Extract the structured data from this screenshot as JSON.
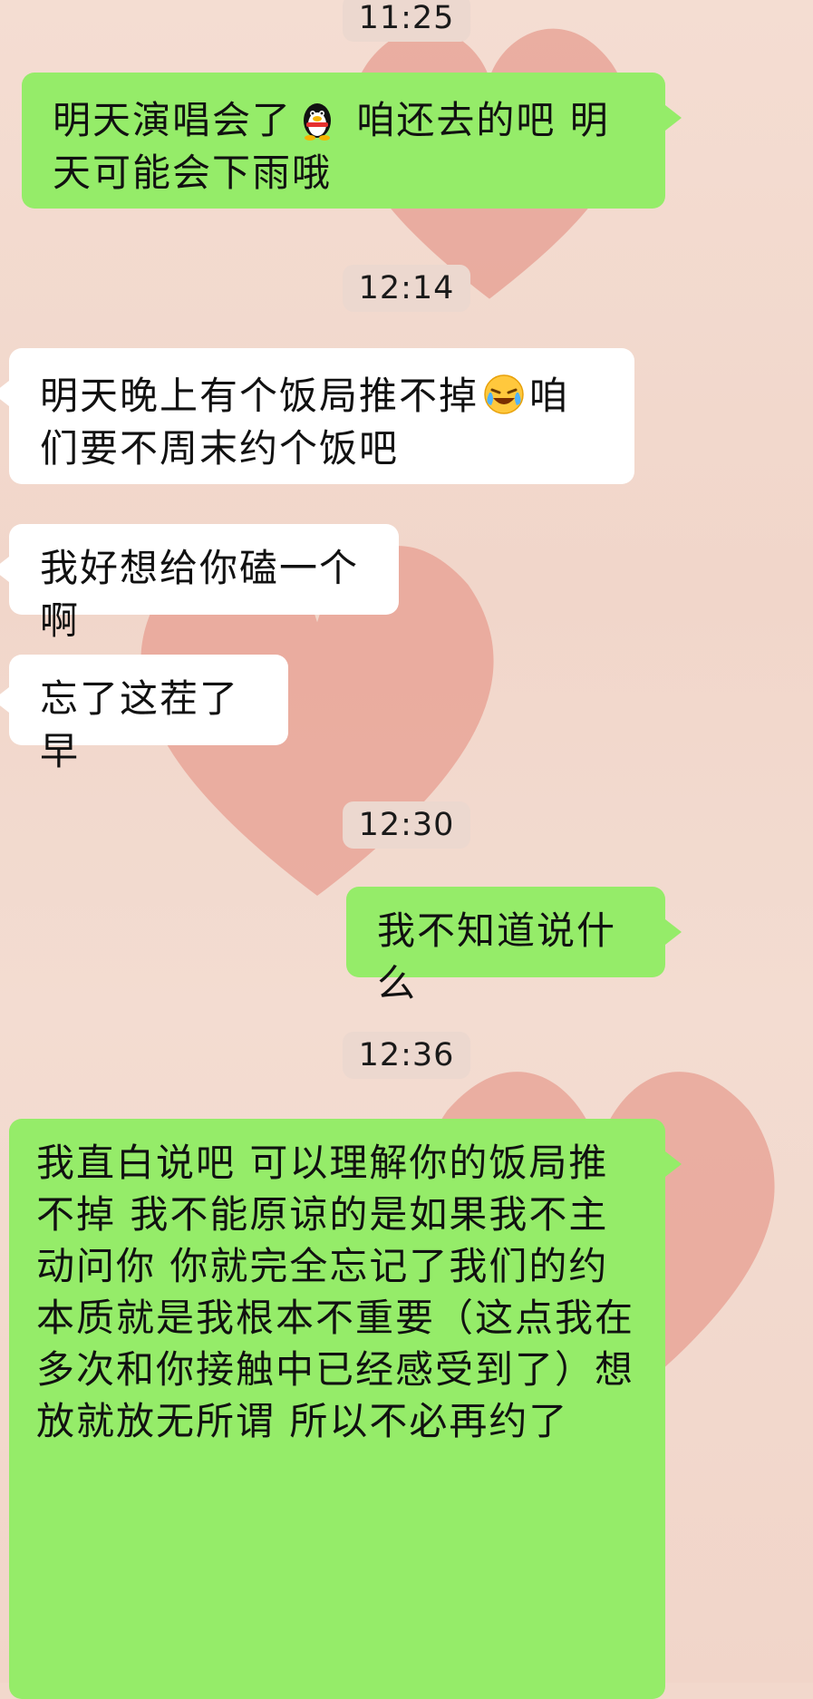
{
  "messages": [
    {
      "kind": "time",
      "text": "11:25"
    },
    {
      "kind": "me",
      "before_emoji": "明天演唱会了",
      "emoji": "penguin-icon",
      "after_emoji": " 咱还去的吧 明天可能会下雨哦"
    },
    {
      "kind": "time",
      "text": "12:14"
    },
    {
      "kind": "them",
      "before_emoji": "明天晚上有个饭局推不掉",
      "emoji": "laughing-crying-icon",
      "after_emoji": "咱们要不周末约个饭吧"
    },
    {
      "kind": "them",
      "text": "我好想给你磕一个啊"
    },
    {
      "kind": "them",
      "text": "忘了这茬了早"
    },
    {
      "kind": "time",
      "text": "12:30"
    },
    {
      "kind": "me",
      "text": "我不知道说什么"
    },
    {
      "kind": "time",
      "text": "12:36"
    },
    {
      "kind": "me",
      "text": "我直白说吧 可以理解你的饭局推不掉 我不能原谅的是如果我不主动问你 你就完全忘记了我们的约 本质就是我根本不重要（这点我在多次和你接触中已经感受到了）想放就放无所谓 所以不必再约了"
    }
  ],
  "colors": {
    "me_bubble": "#95ec69",
    "them_bubble": "#ffffff",
    "background": "#f2d8cc",
    "heart": "#e2887a"
  }
}
